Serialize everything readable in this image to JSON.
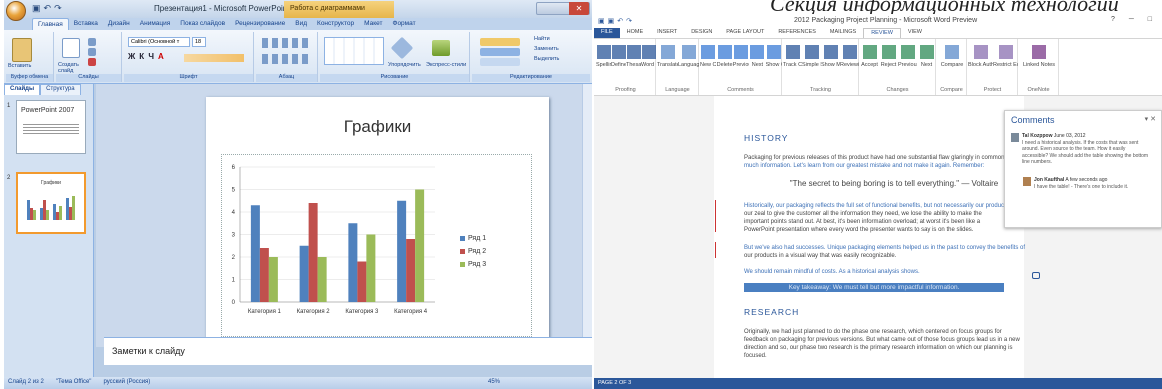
{
  "caption": "Секция информационных технологий",
  "powerpoint": {
    "window_title": "Презентация1 - Microsoft PowerPoint",
    "context_tab": "Работа с диаграммами",
    "tabs": [
      "Главная",
      "Вставка",
      "Дизайн",
      "Анимация",
      "Показ слайдов",
      "Рецензирование",
      "Вид",
      "Конструктор",
      "Макет",
      "Формат"
    ],
    "active_tab": "Главная",
    "groups": [
      "Буфер обмена",
      "Слайды",
      "Шрифт",
      "Абзац",
      "Рисование",
      "Редактирование"
    ],
    "ribbon_labels": {
      "paste": "Вставить",
      "new_slide": "Создать слайд",
      "font_name": "Calibri (Основной т",
      "font_size": "18",
      "arrange": "Упорядочить",
      "quick_styles": "Экспресс-стили",
      "find": "Найти",
      "replace": "Заменить",
      "select": "Выделить"
    },
    "pane_tabs": [
      "Слайды",
      "Структура"
    ],
    "thumbnails": [
      {
        "num": "1",
        "title": "PowerPoint 2007"
      },
      {
        "num": "2",
        "title": "Графики"
      }
    ],
    "slide_title": "Графики",
    "notes_placeholder": "Заметки к слайду",
    "status": {
      "slide": "Слайд 2 из 2",
      "theme": "\"Тема Office\"",
      "lang": "русский (Россия)",
      "zoom": "45%"
    },
    "chart_data": {
      "type": "bar",
      "categories": [
        "Категория 1",
        "Категория 2",
        "Категория 3",
        "Категория 4"
      ],
      "series": [
        {
          "name": "Ряд 1",
          "values": [
            4.3,
            2.5,
            3.5,
            4.5
          ],
          "color": "#4f81bd"
        },
        {
          "name": "Ряд 2",
          "values": [
            2.4,
            4.4,
            1.8,
            2.8
          ],
          "color": "#c0504d"
        },
        {
          "name": "Ряд 3",
          "values": [
            2,
            2,
            3,
            5
          ],
          "color": "#9bbb59"
        }
      ],
      "ylim": [
        0,
        6
      ],
      "yticks": [
        "0",
        "1",
        "2",
        "3",
        "4",
        "5",
        "6"
      ],
      "legend": "right",
      "grid": true
    }
  },
  "word": {
    "window_title": "2012 Packaging Project Planning - Microsoft Word Preview",
    "tabs": [
      "FILE",
      "HOME",
      "INSERT",
      "DESIGN",
      "PAGE LAYOUT",
      "REFERENCES",
      "MAILINGS",
      "REVIEW",
      "VIEW"
    ],
    "active_tab": "REVIEW",
    "groups": [
      {
        "label": "Proofing",
        "buttons": [
          "Spelling & Grammar",
          "Define",
          "Thesaurus",
          "Word Count"
        ]
      },
      {
        "label": "Language",
        "buttons": [
          "Translate",
          "Language"
        ]
      },
      {
        "label": "Comments",
        "buttons": [
          "New Comment",
          "Delete",
          "Previous",
          "Next",
          "Show Comments"
        ]
      },
      {
        "label": "Tracking",
        "buttons": [
          "Track Changes",
          "Simple Markup",
          "Show Markup",
          "Reviewing Pane"
        ]
      },
      {
        "label": "Changes",
        "buttons": [
          "Accept",
          "Reject",
          "Previous",
          "Next"
        ]
      },
      {
        "label": "Compare",
        "buttons": [
          "Compare"
        ]
      },
      {
        "label": "Protect",
        "buttons": [
          "Block Authors",
          "Restrict Editing"
        ]
      },
      {
        "label": "OneNote",
        "buttons": [
          "Linked Notes"
        ]
      }
    ],
    "doc": {
      "h1": "HISTORY",
      "p1": "Packaging for previous releases of this product have had one substantial flaw glaringly in common",
      "p1b": "much information. Let's learn from our greatest mistake and not make it again. Remember:",
      "quote": "\"The secret to being boring is to tell everything.\" — Voltaire",
      "p2": "Historically, our packaging reflects the full set of functional benefits, but not necessarily our product.",
      "p2b": "our zeal to give the customer all the information they need, we lose the ability to make the",
      "p2c": "important points stand out. At best, it's been information overload; at worst it's been like a",
      "p2d": "PowerPoint presentation where every word the presenter wants to say is on the slides.",
      "p3": "But we've also had successes. Unique packaging elements helped us in the past to convey the benefits of",
      "p3b": "our products in a visual way that was easily recognizable.",
      "p4": "We should remain mindful of costs. As a historical analysis shows.",
      "key": "Key takeaway: We must tell but more impactful information.",
      "h2": "RESEARCH",
      "p5": "Originally, we had just planned to do the phase one research, which centered on focus groups for",
      "p5b": "feedback on packaging for previous versions. But what came out of those focus groups lead us in a new",
      "p5c": "direction and so, our phase two research is the primary research information on which our planning is",
      "p5d": "focused."
    },
    "comments": {
      "title": "Comments",
      "items": [
        {
          "author": "Tal Kozppow",
          "date": "June 03, 2012",
          "text": "I need a historical analysis. If the costs that was sent around. Even source to the team. How it easily accessible? We should add the table showing the bottom line numbers."
        },
        {
          "author": "Jon Kaufthal",
          "date": "A few seconds ago",
          "text": "I have the table! - There's one to include it."
        }
      ]
    },
    "status": "PAGE 2 OF 3"
  }
}
